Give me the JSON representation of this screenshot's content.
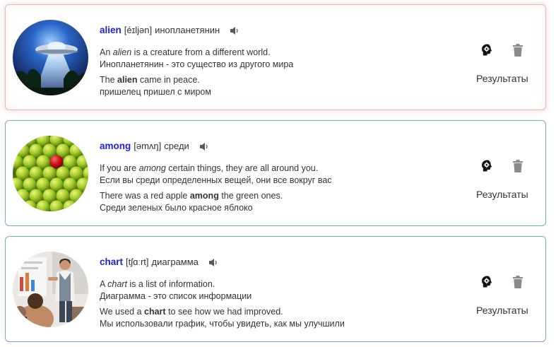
{
  "cards": [
    {
      "word": "alien",
      "transcription": "[éɪljən]",
      "translation": "инопланетянин",
      "def_pre": "An ",
      "def_word": "alien",
      "def_post": " is a creature from a different world.",
      "def_ru": "Инопланетянин - это существо из другого мира",
      "ex_pre": "The ",
      "ex_word": "alien",
      "ex_post": " came in peace.",
      "ex_ru": "пришелец пришел с миром",
      "results_label": "Результаты",
      "image": "ufo-image"
    },
    {
      "word": "among",
      "transcription": "[əmʌŋ]",
      "translation": "среди",
      "def_pre": "If you are ",
      "def_word": "among",
      "def_post": " certain things, they are all around you.",
      "def_ru": "Если вы среди определенных вещей, они все вокруг вас",
      "ex_pre": "There was a red apple ",
      "ex_word": "among",
      "ex_post": " the green ones.",
      "ex_ru": "Среди зеленых было красное яблоко",
      "results_label": "Результаты",
      "image": "apples-image"
    },
    {
      "word": "chart",
      "transcription": "[tʃɑːrt]",
      "translation": "диаграмма",
      "def_pre": "A ",
      "def_word": "chart",
      "def_post": " is a list of information.",
      "def_ru": "Диаграмма - это список информации",
      "ex_pre": "We used a ",
      "ex_word": "chart",
      "ex_post": " to see how we had improved.",
      "ex_ru": "Мы использовали график, чтобы увидеть, как мы улучшили",
      "results_label": "Результаты",
      "image": "presentation-image"
    }
  ],
  "colors": {
    "word": "#1f1fd6",
    "card_border": "#7aa6d8",
    "highlight_border": "#e3b7b7",
    "trash": "#8a8a8a"
  },
  "icons": [
    "speaker-icon",
    "brain-gear-icon",
    "trash-icon"
  ]
}
